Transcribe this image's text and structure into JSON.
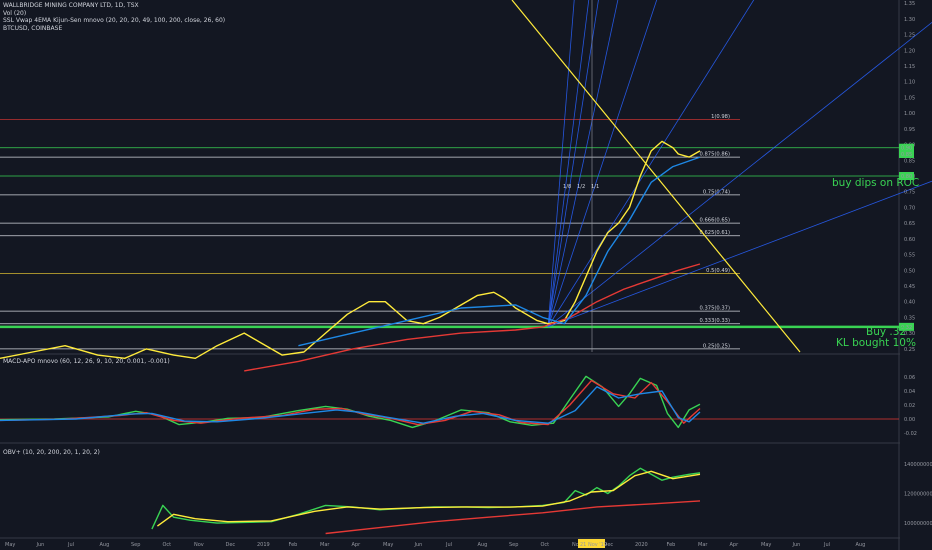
{
  "header": {
    "title": "WALLBRIDGE MINING COMPANY LTD, 1D, TSX",
    "indicators": [
      "Vol (20)",
      "SSL Vwap 4EMA Kijun-Sen mnovo (20, 20, 20, 49, 100, 200, close, 26, 60)",
      "BTCUSD, COINBASE"
    ]
  },
  "annotations": {
    "buy_dips": "buy dips on ROC",
    "buy_32": "Buy .32",
    "kl_bought": "KL bought 10%"
  },
  "colors": {
    "background": "#131722",
    "price_yellow": "#ffeb3b",
    "ema_red": "#e53935",
    "ema_blue": "#1e88e5",
    "green": "#39d353",
    "fib_white": "#d1d4dc",
    "fan_blue": "#2962ff"
  },
  "chart_data": [
    {
      "type": "line",
      "panel": "price",
      "y_axis_ticks": [
        "1.35",
        "1.30",
        "1.25",
        "1.20",
        "1.15",
        "1.10",
        "1.05",
        "1.00",
        "0.95",
        "0.90",
        "0.85",
        "0.80",
        "0.75",
        "0.70",
        "0.65",
        "0.60",
        "0.55",
        "0.50",
        "0.45",
        "0.40",
        "0.35",
        "0.30",
        "0.25"
      ],
      "ylim": [
        0.24,
        1.36
      ],
      "price_labels": {
        "top": "0.90",
        "second": "0.85",
        "green_level": "0.80",
        "bottom_green": "0.32"
      },
      "fib_levels": [
        {
          "label": "1(0.98)",
          "value": 0.98,
          "color": "#e53935"
        },
        {
          "label": "0.875(0.86)",
          "value": 0.86,
          "color": "#d1d4dc"
        },
        {
          "label": "0.75(0.74)",
          "value": 0.74,
          "color": "#d1d4dc"
        },
        {
          "label": "0.666(0.65)",
          "value": 0.65,
          "color": "#d1d4dc"
        },
        {
          "label": "0.625(0.61)",
          "value": 0.61,
          "color": "#d1d4dc"
        },
        {
          "label": "0.5(0.49)",
          "value": 0.49,
          "color": "#fdd835"
        },
        {
          "label": "0.375(0.37)",
          "value": 0.37,
          "color": "#d1d4dc"
        },
        {
          "label": "0.333(0.33)",
          "value": 0.33,
          "color": "#d1d4dc"
        },
        {
          "label": "0.25(0.25)",
          "value": 0.25,
          "color": "#d1d4dc"
        }
      ],
      "horizontal_levels": [
        {
          "value": 0.89,
          "color": "#39d353"
        },
        {
          "value": 0.8,
          "color": "#39d353"
        },
        {
          "value": 0.32,
          "color": "#39d353"
        }
      ],
      "fan_labels": [
        "1/8",
        "1/2",
        "1/1"
      ],
      "series": [
        {
          "color": "#ffeb3b",
          "points": [
            [
              0,
              0.22
            ],
            [
              6,
              0.24
            ],
            [
              12,
              0.26
            ],
            [
              18,
              0.23
            ],
            [
              23,
              0.22
            ],
            [
              27,
              0.25
            ],
            [
              32,
              0.23
            ],
            [
              36,
              0.22
            ],
            [
              40,
              0.26
            ],
            [
              45,
              0.3
            ],
            [
              48,
              0.27
            ],
            [
              52,
              0.23
            ],
            [
              56,
              0.24
            ],
            [
              60,
              0.3
            ],
            [
              64,
              0.36
            ],
            [
              68,
              0.4
            ],
            [
              71,
              0.4
            ],
            [
              73,
              0.37
            ],
            [
              75,
              0.34
            ],
            [
              78,
              0.33
            ],
            [
              81,
              0.35
            ],
            [
              84,
              0.38
            ],
            [
              88,
              0.42
            ],
            [
              91,
              0.43
            ],
            [
              93,
              0.41
            ],
            [
              95,
              0.38
            ],
            [
              97,
              0.36
            ],
            [
              99,
              0.34
            ],
            [
              101,
              0.33
            ],
            [
              104,
              0.34
            ],
            [
              106,
              0.4
            ],
            [
              108,
              0.48
            ],
            [
              110,
              0.56
            ],
            [
              112,
              0.62
            ],
            [
              114,
              0.65
            ],
            [
              116,
              0.7
            ],
            [
              118,
              0.8
            ],
            [
              120,
              0.88
            ],
            [
              122,
              0.91
            ],
            [
              124,
              0.89
            ],
            [
              125,
              0.87
            ],
            [
              127,
              0.86
            ],
            [
              129,
              0.88
            ]
          ]
        },
        {
          "color": "#e53935",
          "points": [
            [
              45,
              0.18
            ],
            [
              55,
              0.21
            ],
            [
              65,
              0.25
            ],
            [
              75,
              0.28
            ],
            [
              85,
              0.3
            ],
            [
              95,
              0.31
            ],
            [
              100,
              0.32
            ],
            [
              105,
              0.35
            ],
            [
              110,
              0.4
            ],
            [
              115,
              0.44
            ],
            [
              120,
              0.47
            ],
            [
              125,
              0.5
            ],
            [
              129,
              0.52
            ]
          ]
        },
        {
          "color": "#1e88e5",
          "points": [
            [
              55,
              0.26
            ],
            [
              65,
              0.3
            ],
            [
              75,
              0.34
            ],
            [
              85,
              0.38
            ],
            [
              95,
              0.39
            ],
            [
              100,
              0.35
            ],
            [
              104,
              0.33
            ],
            [
              108,
              0.42
            ],
            [
              112,
              0.56
            ],
            [
              116,
              0.66
            ],
            [
              120,
              0.78
            ],
            [
              124,
              0.83
            ],
            [
              129,
              0.86
            ]
          ]
        }
      ]
    },
    {
      "type": "line",
      "panel": "macd",
      "title": "MACD-APO mnovo (60, 12, 26, 9, 10, 20, 0.001, -0.001)",
      "y_axis_ticks": [
        "0.06",
        "0.04",
        "0.02",
        "0.00",
        "-0.02"
      ],
      "ylim": [
        -0.03,
        0.07
      ],
      "series": [
        {
          "color": "#39d353",
          "points": [
            [
              0,
              -0.001
            ],
            [
              10,
              0.0
            ],
            [
              20,
              0.003
            ],
            [
              25,
              0.011
            ],
            [
              29,
              0.006
            ],
            [
              33,
              -0.008
            ],
            [
              38,
              -0.004
            ],
            [
              42,
              0.001
            ],
            [
              48,
              0.002
            ],
            [
              55,
              0.012
            ],
            [
              60,
              0.018
            ],
            [
              64,
              0.014
            ],
            [
              68,
              0.004
            ],
            [
              72,
              -0.002
            ],
            [
              76,
              -0.012
            ],
            [
              80,
              -0.003
            ],
            [
              85,
              0.013
            ],
            [
              90,
              0.009
            ],
            [
              94,
              -0.004
            ],
            [
              98,
              -0.009
            ],
            [
              102,
              -0.006
            ],
            [
              105,
              0.028
            ],
            [
              108,
              0.061
            ],
            [
              111,
              0.046
            ],
            [
              114,
              0.018
            ],
            [
              116,
              0.036
            ],
            [
              118,
              0.058
            ],
            [
              121,
              0.048
            ],
            [
              123,
              0.008
            ],
            [
              125,
              -0.012
            ],
            [
              127,
              0.013
            ],
            [
              129,
              0.021
            ]
          ]
        },
        {
          "color": "#e53935",
          "points": [
            [
              0,
              -0.002
            ],
            [
              12,
              0.0
            ],
            [
              22,
              0.005
            ],
            [
              27,
              0.009
            ],
            [
              32,
              -0.002
            ],
            [
              37,
              -0.006
            ],
            [
              44,
              0.001
            ],
            [
              52,
              0.005
            ],
            [
              58,
              0.014
            ],
            [
              63,
              0.015
            ],
            [
              67,
              0.007
            ],
            [
              72,
              0.001
            ],
            [
              77,
              -0.008
            ],
            [
              82,
              -0.002
            ],
            [
              87,
              0.011
            ],
            [
              92,
              0.006
            ],
            [
              96,
              -0.005
            ],
            [
              101,
              -0.008
            ],
            [
              105,
              0.02
            ],
            [
              109,
              0.055
            ],
            [
              113,
              0.036
            ],
            [
              117,
              0.03
            ],
            [
              120,
              0.052
            ],
            [
              123,
              0.025
            ],
            [
              126,
              -0.006
            ],
            [
              129,
              0.015
            ]
          ]
        },
        {
          "color": "#1e88e5",
          "points": [
            [
              0,
              -0.002
            ],
            [
              14,
              0.0
            ],
            [
              24,
              0.007
            ],
            [
              28,
              0.008
            ],
            [
              34,
              -0.003
            ],
            [
              40,
              -0.004
            ],
            [
              48,
              0.001
            ],
            [
              56,
              0.008
            ],
            [
              62,
              0.013
            ],
            [
              66,
              0.01
            ],
            [
              71,
              0.003
            ],
            [
              78,
              -0.006
            ],
            [
              84,
              0.004
            ],
            [
              89,
              0.008
            ],
            [
              95,
              -0.002
            ],
            [
              101,
              -0.006
            ],
            [
              106,
              0.012
            ],
            [
              110,
              0.046
            ],
            [
              114,
              0.03
            ],
            [
              118,
              0.036
            ],
            [
              122,
              0.04
            ],
            [
              125,
              0.002
            ],
            [
              127,
              -0.004
            ],
            [
              129,
              0.01
            ]
          ]
        }
      ]
    },
    {
      "type": "line",
      "panel": "obv",
      "title": "OBV+ (10, 20, 200, 20, 1, 20, 2)",
      "y_axis_ticks": [
        "140000000.00",
        "120000000.00",
        "100000000.00"
      ],
      "ylim": [
        92000000,
        146000000
      ],
      "series": [
        {
          "color": "#39d353",
          "points": [
            [
              28,
              96000000
            ],
            [
              30,
              112000000
            ],
            [
              32,
              104000000
            ],
            [
              35,
              102000000
            ],
            [
              40,
              100000000
            ],
            [
              45,
              100500000
            ],
            [
              50,
              101000000
            ],
            [
              55,
              106000000
            ],
            [
              60,
              112000000
            ],
            [
              65,
              111000000
            ],
            [
              70,
              109000000
            ],
            [
              75,
              110000000
            ],
            [
              80,
              111000000
            ],
            [
              85,
              111000000
            ],
            [
              90,
              110500000
            ],
            [
              95,
              111000000
            ],
            [
              100,
              112000000
            ],
            [
              104,
              114000000
            ],
            [
              106,
              122000000
            ],
            [
              108,
              119000000
            ],
            [
              110,
              124000000
            ],
            [
              112,
              120000000
            ],
            [
              114,
              125000000
            ],
            [
              116,
              132000000
            ],
            [
              118,
              137000000
            ],
            [
              120,
              133000000
            ],
            [
              122,
              129000000
            ],
            [
              124,
              131000000
            ],
            [
              127,
              133000000
            ],
            [
              129,
              134000000
            ]
          ]
        },
        {
          "color": "#ffeb3b",
          "points": [
            [
              29,
              98000000
            ],
            [
              32,
              106000000
            ],
            [
              36,
              103000000
            ],
            [
              42,
              101000000
            ],
            [
              50,
              101500000
            ],
            [
              58,
              108000000
            ],
            [
              64,
              111000000
            ],
            [
              70,
              109500000
            ],
            [
              78,
              110500000
            ],
            [
              86,
              111000000
            ],
            [
              94,
              110800000
            ],
            [
              100,
              111500000
            ],
            [
              105,
              115000000
            ],
            [
              109,
              121000000
            ],
            [
              113,
              122000000
            ],
            [
              117,
              132000000
            ],
            [
              120,
              135000000
            ],
            [
              124,
              130000000
            ],
            [
              129,
              133000000
            ]
          ]
        },
        {
          "color": "#e53935",
          "points": [
            [
              60,
              93000000
            ],
            [
              70,
              97000000
            ],
            [
              80,
              101000000
            ],
            [
              90,
              104000000
            ],
            [
              100,
              107000000
            ],
            [
              110,
              111000000
            ],
            [
              120,
              113000000
            ],
            [
              129,
              115000000
            ]
          ]
        }
      ]
    }
  ],
  "x_axis": {
    "labels": [
      "May",
      "Jun",
      "Jul",
      "Aug",
      "Sep",
      "Oct",
      "Nov",
      "Dec",
      "2019",
      "Feb",
      "Mar",
      "Apr",
      "May",
      "Jun",
      "Jul",
      "Aug",
      "Sep",
      "Oct",
      "Nov",
      "Dec",
      "2020",
      "Feb",
      "Mar",
      "Apr",
      "May",
      "Jun",
      "Jul",
      "Aug"
    ],
    "highlight": "21 Nov '19"
  }
}
